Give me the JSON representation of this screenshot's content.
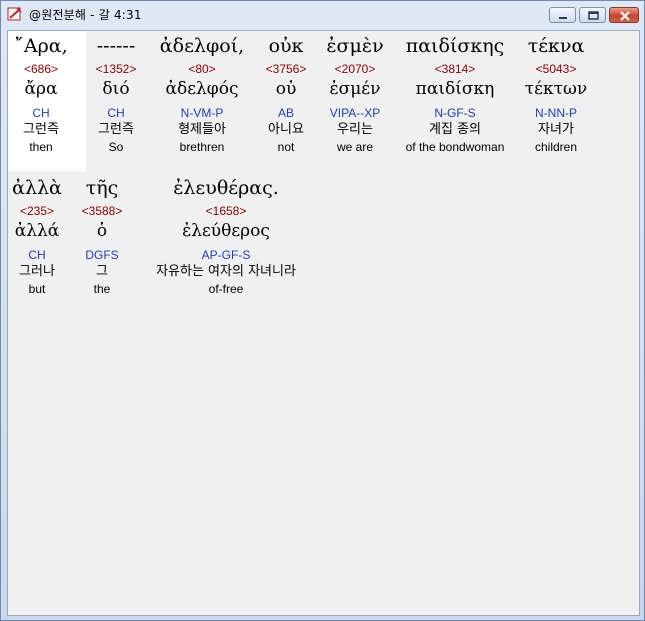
{
  "window": {
    "title": "@원전분해 - 갈 4:31",
    "buttons": {
      "minimize": "minimize",
      "maximize": "maximize",
      "close": "close"
    }
  },
  "words": [
    {
      "greek": "῎Αρα,",
      "strong": "<686>",
      "lemma": "ἄρα",
      "parse": "CH",
      "korean": "그런즉",
      "english": "then"
    },
    {
      "greek": "------",
      "strong": "<1352>",
      "lemma": "διό",
      "parse": "CH",
      "korean": "그런즉",
      "english": "So"
    },
    {
      "greek": "ἀδελφοί,",
      "strong": "<80>",
      "lemma": "ἀδελφός",
      "parse": "N-VM-P",
      "korean": "형제들아",
      "english": "brethren"
    },
    {
      "greek": "οὐκ",
      "strong": "<3756>",
      "lemma": "οὐ",
      "parse": "AB",
      "korean": "아니요",
      "english": "not"
    },
    {
      "greek": "ἐσμὲν",
      "strong": "<2070>",
      "lemma": "ἐσμέν",
      "parse": "VIPA--XP",
      "korean": "우리는",
      "english": "we are"
    },
    {
      "greek": "παιδίσκης",
      "strong": "<3814>",
      "lemma": "παιδίσκη",
      "parse": "N-GF-S",
      "korean": "계집 종의",
      "english": "of the bondwoman"
    },
    {
      "greek": "τέκνα",
      "strong": "<5043>",
      "lemma": "τέκτων",
      "parse": "N-NN-P",
      "korean": "자녀가",
      "english": "children"
    },
    {
      "greek": "ἀλλὰ",
      "strong": "<235>",
      "lemma": "ἀλλά",
      "parse": "CH",
      "korean": "그러나",
      "english": "but"
    },
    {
      "greek": "τῆς",
      "strong": "<3588>",
      "lemma": "ὁ",
      "parse": "DGFS",
      "korean": "그",
      "english": "the"
    },
    {
      "greek": "ἐλευθέρας.",
      "strong": "<1658>",
      "lemma": "ἐλεύθερος",
      "parse": "AP-GF-S",
      "korean": "자유하는 여자의 자녀니라",
      "english": "of-free"
    }
  ]
}
